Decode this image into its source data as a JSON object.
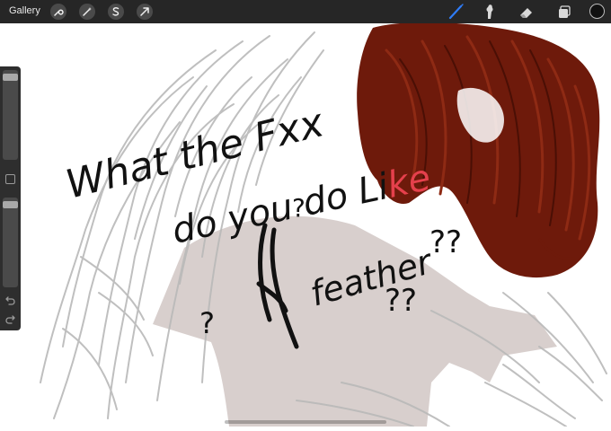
{
  "toolbar": {
    "gallery_label": "Gallery",
    "left_icons": [
      "wrench-icon",
      "magic-wand-icon",
      "selection-icon",
      "transform-arrow-icon"
    ],
    "right_icons": [
      "brush-icon",
      "smudge-icon",
      "eraser-icon",
      "layers-icon"
    ],
    "active_tool": "brush",
    "accent_color": "#2f7cf6",
    "current_color": "#111111"
  },
  "sidebar": {
    "brush_size_level": 0.04,
    "opacity_level": 0.04,
    "undo_icon": "undo-icon",
    "redo_icon": "redo-icon"
  },
  "canvas": {
    "background": "#ffffff",
    "hair_color": "#6e1a0b",
    "shirt_color": "#d8cfcd",
    "handwriting": {
      "line1": "What the Fxx",
      "line2_main": "do you do Li",
      "line2_red": "ke",
      "line3": "feather",
      "marks": "??"
    }
  }
}
